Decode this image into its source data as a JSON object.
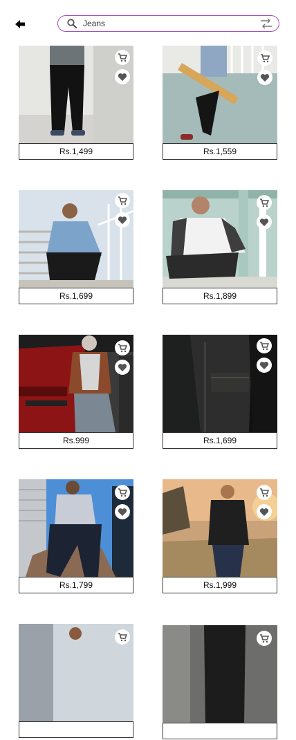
{
  "search": {
    "value": "Jeans",
    "placeholder": "Search"
  },
  "icons": {
    "back": "arrow-left-icon",
    "search": "search-icon",
    "filter": "filter-sort-icon",
    "cart": "cart-icon",
    "wishlist": "heart-icon"
  },
  "colors": {
    "search_border": "#a450b8"
  },
  "products": [
    {
      "price": "Rs.1,499"
    },
    {
      "price": "Rs.1,559"
    },
    {
      "price": "Rs.1,699"
    },
    {
      "price": "Rs.1,899"
    },
    {
      "price": "Rs.999"
    },
    {
      "price": "Rs.1,699"
    },
    {
      "price": "Rs.1,799"
    },
    {
      "price": "Rs.1,999"
    },
    {
      "price": ""
    },
    {
      "price": ""
    }
  ]
}
